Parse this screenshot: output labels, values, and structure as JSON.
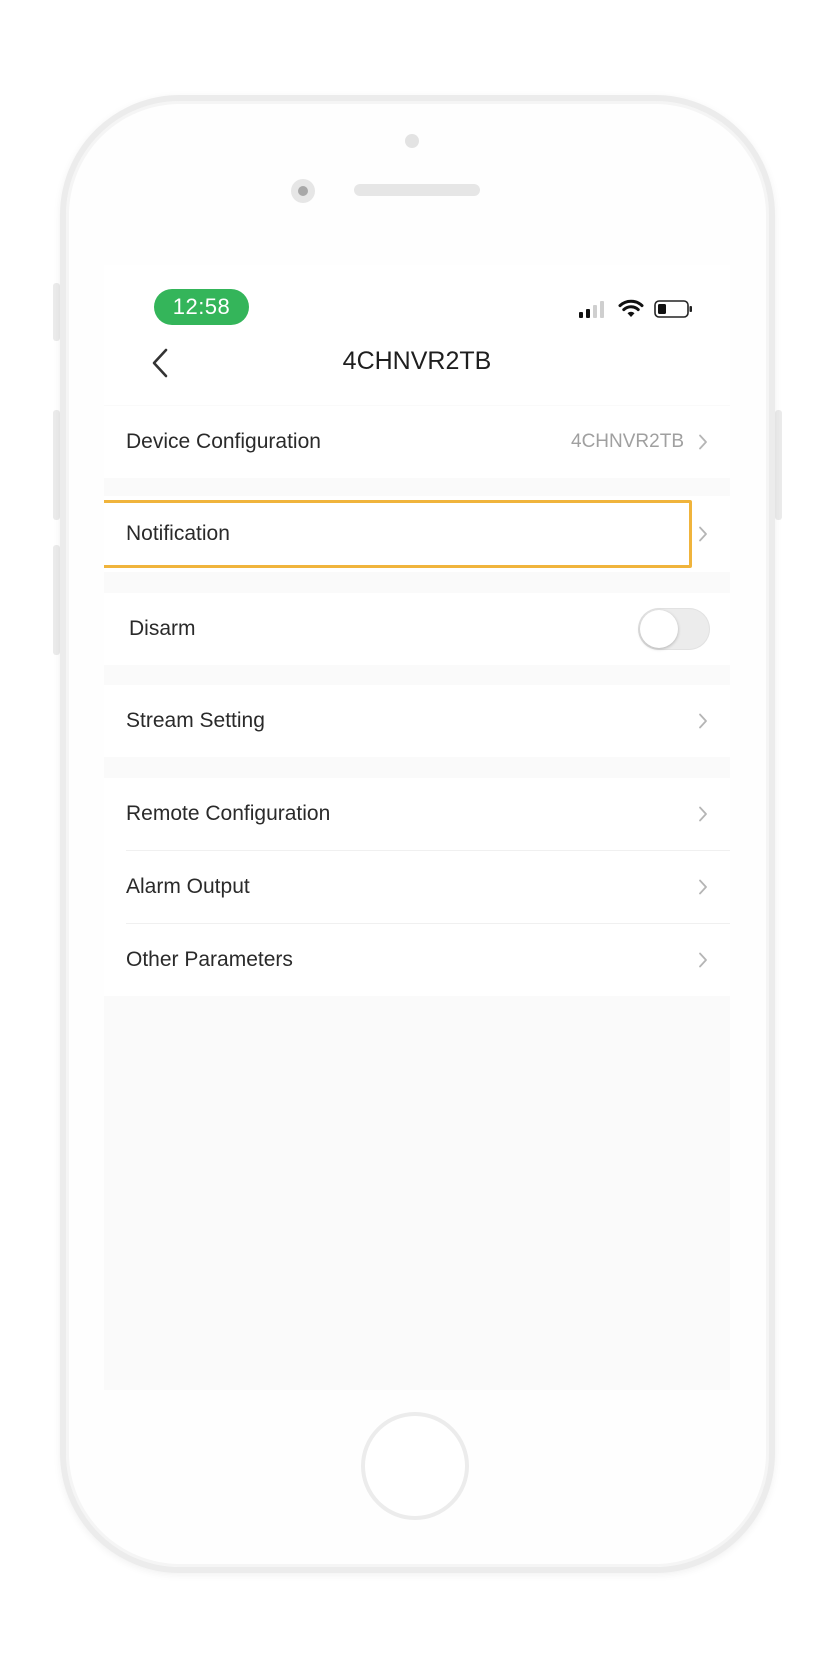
{
  "status_bar": {
    "time": "12:58",
    "time_pill_color": "#34b55a",
    "icons": [
      "signal-icon",
      "wifi-icon",
      "battery-icon"
    ]
  },
  "nav": {
    "title": "4CHNVR2TB",
    "back_icon": "chevron-left-icon"
  },
  "settings": {
    "device_configuration": {
      "label": "Device Configuration",
      "value": "4CHNVR2TB"
    },
    "notification": {
      "label": "Notification",
      "highlighted": true,
      "highlight_color": "#f0b43c"
    },
    "disarm": {
      "label": "Disarm",
      "enabled": false
    },
    "stream_setting": {
      "label": "Stream Setting"
    },
    "remote_configuration": {
      "label": "Remote Configuration"
    },
    "alarm_output": {
      "label": "Alarm Output"
    },
    "other_parameters": {
      "label": "Other Parameters"
    }
  }
}
